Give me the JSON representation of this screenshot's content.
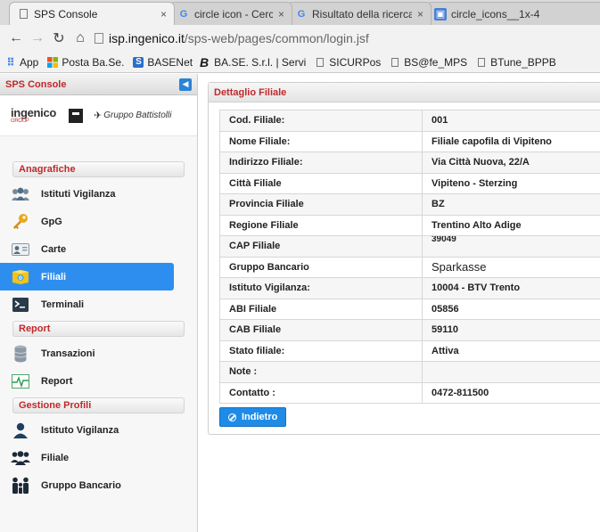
{
  "browser": {
    "tabs": [
      {
        "title": "SPS Console",
        "icon": "page-icon",
        "active": true
      },
      {
        "title": "circle icon - Cerca co",
        "icon": "google-icon",
        "active": false
      },
      {
        "title": "Risultato della ricerca",
        "icon": "google-icon",
        "active": false
      },
      {
        "title": "circle_icons__1x-4",
        "icon": "image-icon",
        "active": false
      }
    ],
    "tab_close": "×",
    "url_host": "isp.ingenico.it",
    "url_path": "/sps-web/pages/common/login.jsf",
    "bookmarks": [
      {
        "label": "App",
        "icon": "apps-grid-icon"
      },
      {
        "label": "Posta Ba.Se.",
        "icon": "windows-icon"
      },
      {
        "label": "BASENet",
        "icon": "basenet-icon"
      },
      {
        "label": "BA.SE. S.r.l. | Servi",
        "icon": "b-logo-icon"
      },
      {
        "label": "SICURPos",
        "icon": "page-icon"
      },
      {
        "label": "BS@fe_MPS",
        "icon": "page-icon"
      },
      {
        "label": "BTune_BPPB",
        "icon": "page-icon"
      }
    ],
    "colors": {
      "chrome_bg": "#f2f2f2",
      "tabstrip_bg": "#dbdbdb"
    }
  },
  "sidebar": {
    "title": "SPS Console",
    "logos": {
      "ingenico": "ingenico",
      "ingenico_sub": "GROUP",
      "battistolli": "Gruppo Battistolli"
    },
    "sections": [
      {
        "label": "Anagrafiche",
        "items": [
          {
            "label": "Istituti Vigilanza",
            "icon": "group-icon",
            "active": false
          },
          {
            "label": "GpG",
            "icon": "key-icon",
            "active": false
          },
          {
            "label": "Carte",
            "icon": "id-card-icon",
            "active": false
          },
          {
            "label": "Filiali",
            "icon": "branch-icon",
            "active": true
          },
          {
            "label": "Terminali",
            "icon": "terminal-icon",
            "active": false
          }
        ]
      },
      {
        "label": "Report",
        "items": [
          {
            "label": "Transazioni",
            "icon": "database-icon",
            "active": false
          },
          {
            "label": "Report",
            "icon": "pulse-icon",
            "active": false
          }
        ]
      },
      {
        "label": "Gestione Profili",
        "items": [
          {
            "label": "Istituto Vigilanza",
            "icon": "user-icon",
            "active": false
          },
          {
            "label": "Filiale",
            "icon": "users-icon",
            "active": false
          },
          {
            "label": "Gruppo Bancario",
            "icon": "family-icon",
            "active": false
          }
        ]
      }
    ],
    "colors": {
      "section_text": "#c0292b",
      "active_bg": "#2e8ef0"
    }
  },
  "panel": {
    "title": "Dettaglio Filiale",
    "rows": [
      {
        "label": "Cod. Filiale:",
        "value": "001"
      },
      {
        "label": "Nome Filiale:",
        "value": "Filiale capofila di Vipiteno"
      },
      {
        "label": "Indirizzo Filiale:",
        "value": "Via Città Nuova, 22/A"
      },
      {
        "label": "Città Filiale",
        "value": "Vipiteno - Sterzing"
      },
      {
        "label": "Provincia Filiale",
        "value": "BZ"
      },
      {
        "label": "Regione Filiale",
        "value": "Trentino Alto Adige"
      },
      {
        "label": "CAP Filiale",
        "value": "39049"
      },
      {
        "label": "Gruppo Bancario",
        "value": "Sparkasse"
      },
      {
        "label": "Istituto Vigilanza:",
        "value": "10004 - BTV Trento"
      },
      {
        "label": "ABI Filiale",
        "value": "05856"
      },
      {
        "label": "CAB Filiale",
        "value": "59110"
      },
      {
        "label": "Stato filiale:",
        "value": "Attiva"
      },
      {
        "label": "Note :",
        "value": ""
      },
      {
        "label": "Contatto :",
        "value": "0472-811500"
      }
    ],
    "back_button": "Indietro",
    "colors": {
      "title_text": "#c0292b",
      "button_bg": "#1f8be6"
    }
  }
}
